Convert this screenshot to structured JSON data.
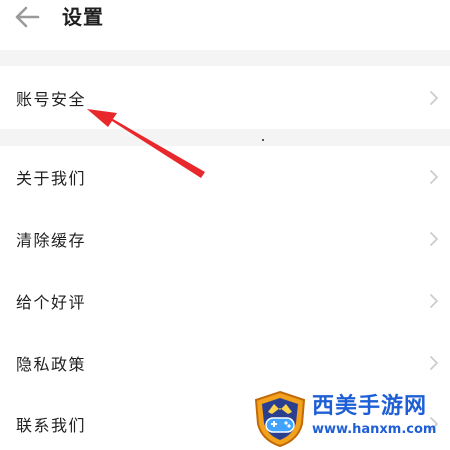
{
  "header": {
    "back_icon": "arrow-left-icon",
    "title": "设置"
  },
  "settings": {
    "items": [
      {
        "label": "账号安全",
        "icon": "chevron-right-icon"
      },
      {
        "label": "关于我们",
        "icon": "chevron-right-icon"
      },
      {
        "label": "清除缓存",
        "icon": "chevron-right-icon"
      },
      {
        "label": "给个好评",
        "icon": "chevron-right-icon"
      },
      {
        "label": "隐私政策",
        "icon": "chevron-right-icon"
      },
      {
        "label": "联系我们",
        "icon": "chevron-right-icon"
      }
    ]
  },
  "annotation": {
    "arrow_color": "#e8282b",
    "points_to": "账号安全"
  },
  "watermark": {
    "title": "西美手游网",
    "url": "www.hanxm.com",
    "color": "#1e5fd6"
  },
  "colors": {
    "text": "#1f1f1f",
    "section_gap": "#f4f4f4",
    "chevron": "#cccccc"
  }
}
